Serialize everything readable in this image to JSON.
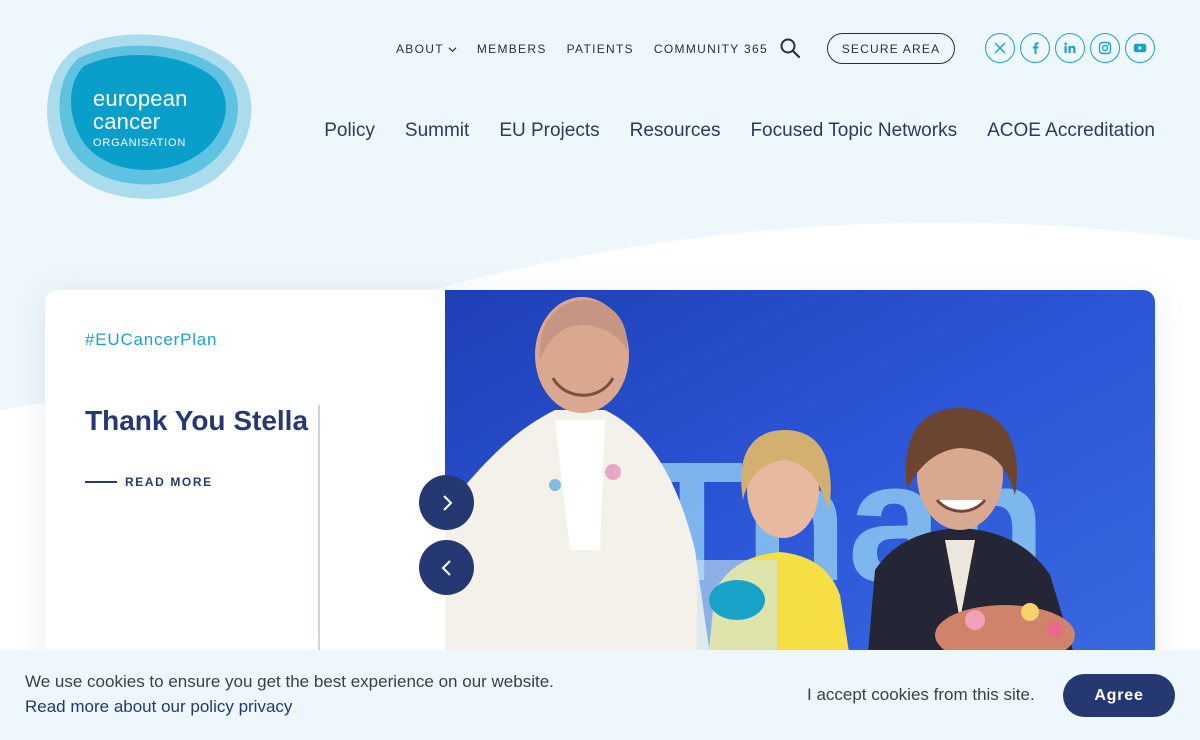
{
  "logo": {
    "line1": "european",
    "line2": "cancer",
    "line3": "ORGANISATION"
  },
  "topnav": {
    "items": [
      "ABOUT",
      "MEMBERS",
      "PATIENTS",
      "COMMUNITY 365"
    ],
    "secure_label": "SECURE AREA"
  },
  "socials": [
    "x-icon",
    "facebook-icon",
    "linkedin-icon",
    "instagram-icon",
    "youtube-icon"
  ],
  "mainnav": {
    "items": [
      "Policy",
      "Summit",
      "EU Projects",
      "Resources",
      "Focused Topic Networks",
      "ACOE Accreditation"
    ]
  },
  "hero": {
    "hashtag": "#EUCancerPlan",
    "title": "Thank You Stella",
    "read_more": "READ MORE"
  },
  "cookie": {
    "message": "We use cookies to ensure you get the best experience on our website.",
    "link": "Read more about our policy privacy",
    "accept_text": "I accept cookies from this site.",
    "agree_label": "Agree"
  },
  "colors": {
    "brand_teal": "#1aa3c9",
    "navy": "#263872",
    "bg": "#eef7fc"
  }
}
